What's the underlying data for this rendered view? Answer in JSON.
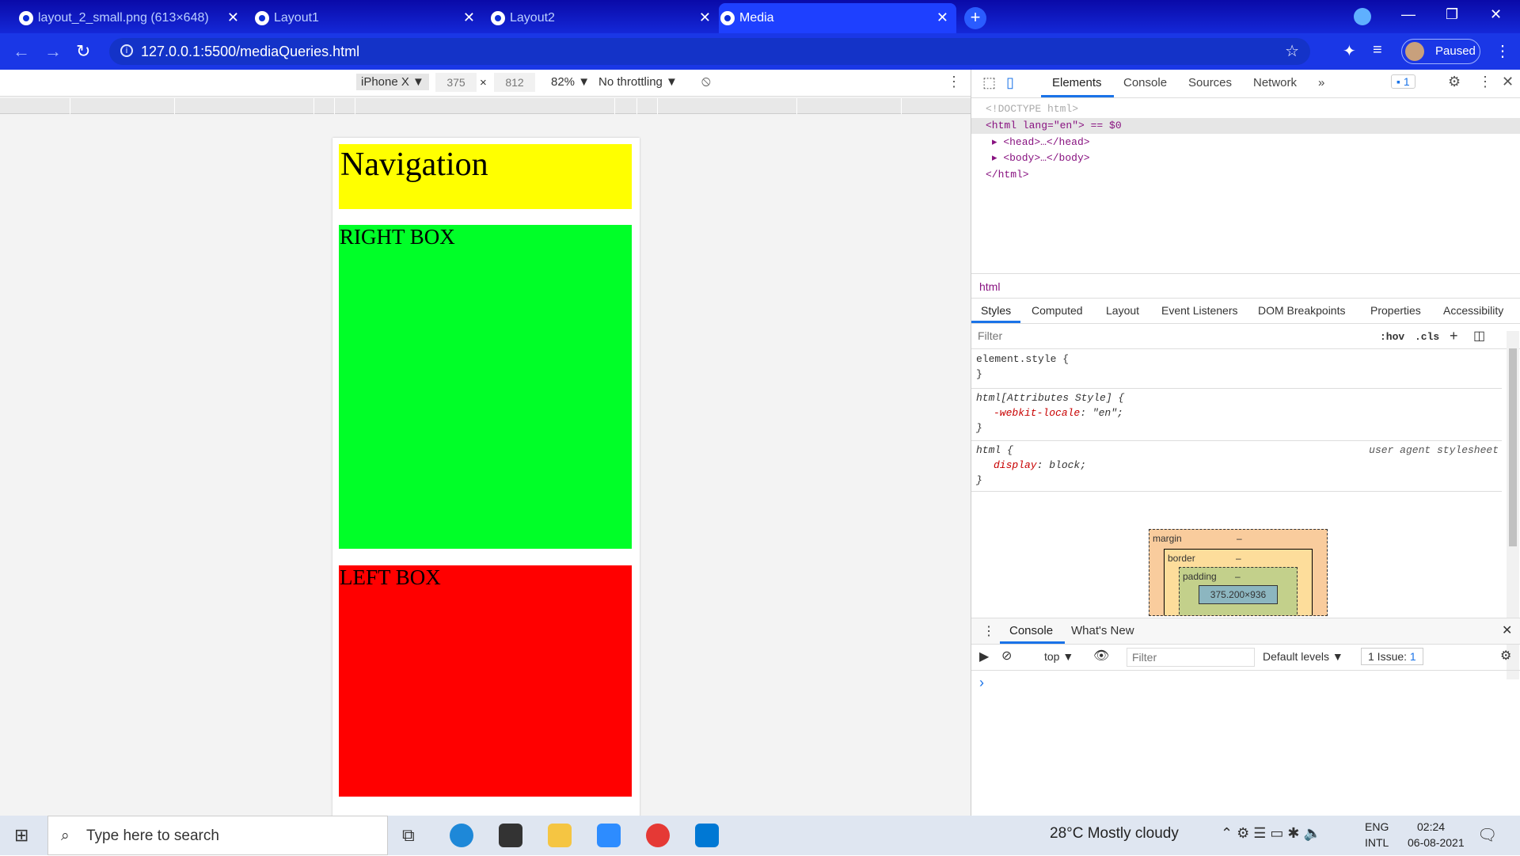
{
  "browser": {
    "tabs": [
      {
        "title": "layout_2_small.png (613×648)"
      },
      {
        "title": "Layout1"
      },
      {
        "title": "Layout2"
      },
      {
        "title": "Media"
      }
    ],
    "url": "127.0.0.1:5500/mediaQueries.html",
    "profile_label": "Paused"
  },
  "device_toolbar": {
    "device": "iPhone X ▼",
    "width": "375",
    "times": "×",
    "height": "812",
    "zoom": "82% ▼",
    "throttling": "No throttling ▼"
  },
  "page": {
    "nav_text": "Navigation",
    "right_box_text": "RIGHT BOX",
    "left_box_text": "LEFT BOX",
    "colors": {
      "nav": "#ffff00",
      "right": "#00ff28",
      "left": "#ff0000"
    }
  },
  "devtools": {
    "tabs": [
      "Elements",
      "Console",
      "Sources",
      "Network"
    ],
    "more": "»",
    "issues_badge": "1",
    "dom": {
      "doctype": "<!DOCTYPE html>",
      "html_open": "<html lang=\"en\"> == $0",
      "head": "<head>…</head>",
      "body": "<body>…</body>",
      "html_close": "</html>"
    },
    "breadcrumb": "html",
    "style_tabs": [
      "Styles",
      "Computed",
      "Layout",
      "Event Listeners",
      "DOM Breakpoints",
      "Properties",
      "Accessibility"
    ],
    "filter_placeholder": "Filter",
    "hov": ":hov",
    "cls": ".cls",
    "rules": {
      "r1_selector": "element.style {",
      "r1_close": "}",
      "r2_selector": "html[Attributes Style] {",
      "r2_prop": "-webkit-locale",
      "r2_val": "\"en\";",
      "r2_close": "}",
      "r3_selector": "html {",
      "r3_source": "user agent stylesheet",
      "r3_prop": "display",
      "r3_val": "block;",
      "r3_close": "}"
    },
    "box_model": {
      "margin": "margin",
      "border": "border",
      "padding": "padding",
      "dash": "–",
      "content": "375.200×936"
    },
    "drawer": {
      "tabs": [
        "Console",
        "What's New"
      ],
      "context": "top ▼",
      "filter_placeholder": "Filter",
      "levels": "Default levels ▼",
      "issues": "1 Issue:",
      "issues_count": "1",
      "prompt": "›"
    }
  },
  "taskbar": {
    "search_placeholder": "Type here to search",
    "weather": "28°C  Mostly cloudy",
    "lang1": "ENG",
    "lang2": "INTL",
    "time": "02:24",
    "date": "06-08-2021"
  }
}
